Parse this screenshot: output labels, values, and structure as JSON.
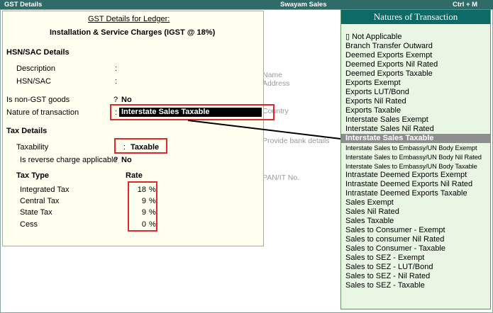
{
  "titlebar": {
    "left": "GST Details",
    "center": "Swayam Sales",
    "right": "Ctrl + M"
  },
  "background_form": {
    "name": "Name",
    "address": "Address",
    "country": "Country",
    "bank": "Provide bank details",
    "pan": "PAN/IT No."
  },
  "panel": {
    "header_line1": "GST Details for Ledger:",
    "header_line2": "Installation & Service Charges (IGST @ 18%)",
    "hsn_section": "HSN/SAC Details",
    "description_label": "Description",
    "hsn_label": "HSN/SAC",
    "colon": ":",
    "non_gst_label": "Is non-GST goods",
    "non_gst_q": "?",
    "non_gst_value": "No",
    "nature_label": "Nature of transaction",
    "nature_value": "Interstate Sales Taxable",
    "tax_details": "Tax Details",
    "taxability_label": "Taxability",
    "taxability_value": "Taxable",
    "reverse_label": "Is reverse charge applicable",
    "reverse_q": "?",
    "reverse_value": "No",
    "tax_type_header": "Tax Type",
    "rate_header": "Rate",
    "taxes": [
      {
        "label": "Integrated Tax",
        "rate": "18",
        "unit": "%"
      },
      {
        "label": "Central Tax",
        "rate": "9",
        "unit": "%"
      },
      {
        "label": "State Tax",
        "rate": "9",
        "unit": "%"
      },
      {
        "label": "Cess",
        "rate": "0",
        "unit": "%"
      }
    ]
  },
  "dropdown": {
    "title": "Natures of Transaction",
    "selected": "Interstate Sales Taxable",
    "items": [
      "▯ Not Applicable",
      "Branch Transfer Outward",
      "Deemed Exports Exempt",
      "Deemed Exports Nil Rated",
      "Deemed Exports Taxable",
      "Exports Exempt",
      "Exports LUT/Bond",
      "Exports Nil Rated",
      "Exports Taxable",
      "Interstate Sales Exempt",
      "Interstate Sales Nil Rated",
      "Interstate Sales Taxable",
      "Interstate Sales to Embassy/UN Body Exempt",
      "Interstate Sales to Embassy/UN Body Nil Rated",
      "Interstate Sales to Embassy/UN Body Taxable",
      "Intrastate Deemed Exports Exempt",
      "Intrastate Deemed Exports Nil Rated",
      "Intrastate Deemed Exports Taxable",
      "Sales Exempt",
      "Sales Nil Rated",
      "Sales Taxable",
      "Sales to Consumer - Exempt",
      "Sales to consumer Nil Rated",
      "Sales to Consumer - Taxable",
      "Sales to SEZ - Exempt",
      "Sales to SEZ - LUT/Bond",
      "Sales to SEZ - Nil Rated",
      "Sales to SEZ - Taxable"
    ]
  },
  "colors": {
    "titlebar": "#2f6b68",
    "dropdown_header": "#0d6b67",
    "dropdown_bg": "#e9f6e4",
    "panel_bg": "#fffff0",
    "highlight": "#e3262d",
    "selected_row": "#8e8e8e"
  }
}
